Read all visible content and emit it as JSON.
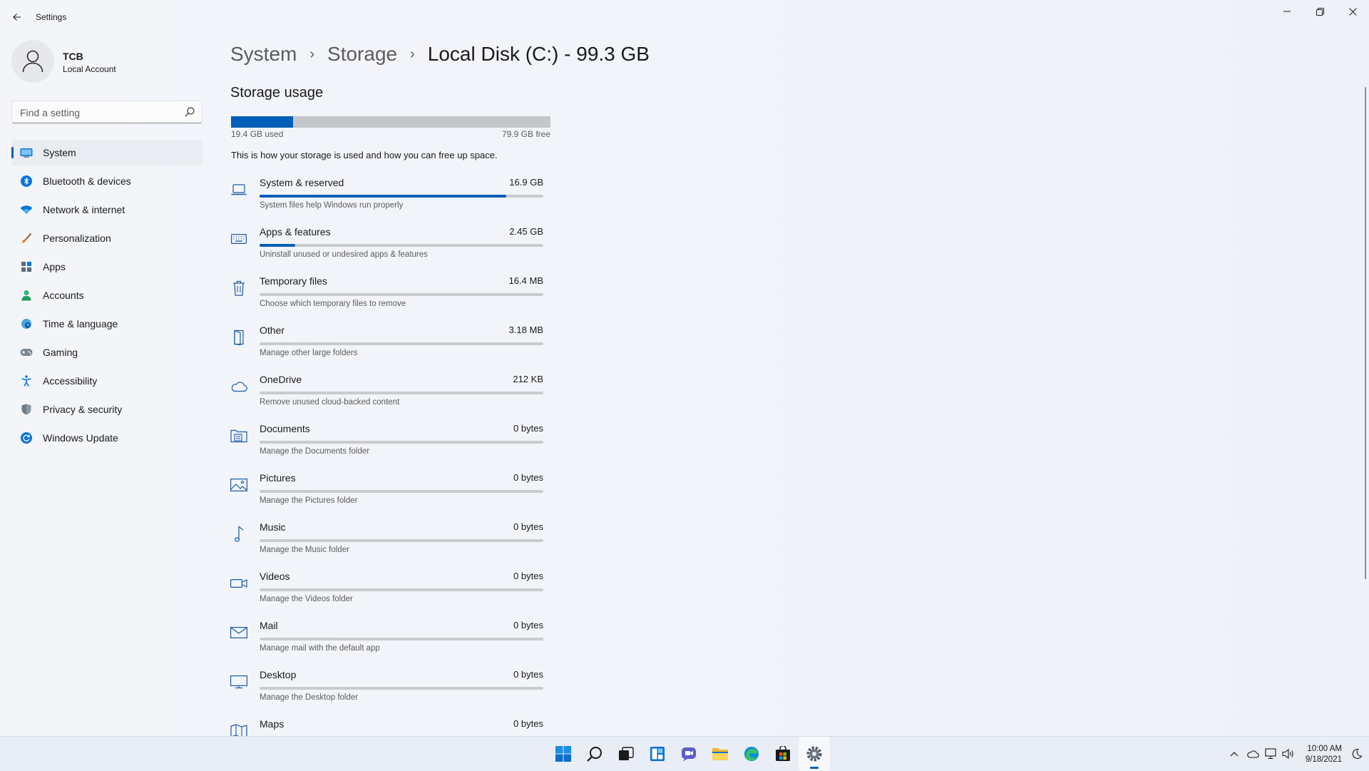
{
  "window": {
    "title": "Settings",
    "controls": [
      "minimize",
      "restore",
      "close"
    ]
  },
  "profile": {
    "name": "TCB",
    "account_type": "Local Account"
  },
  "search": {
    "placeholder": "Find a setting"
  },
  "nav": {
    "items": [
      {
        "label": "System",
        "icon": "system-icon",
        "active": true
      },
      {
        "label": "Bluetooth & devices",
        "icon": "bluetooth-icon"
      },
      {
        "label": "Network & internet",
        "icon": "wifi-icon"
      },
      {
        "label": "Personalization",
        "icon": "brush-icon"
      },
      {
        "label": "Apps",
        "icon": "apps-icon"
      },
      {
        "label": "Accounts",
        "icon": "accounts-icon"
      },
      {
        "label": "Time & language",
        "icon": "globe-clock-icon"
      },
      {
        "label": "Gaming",
        "icon": "gamepad-icon"
      },
      {
        "label": "Accessibility",
        "icon": "accessibility-icon"
      },
      {
        "label": "Privacy & security",
        "icon": "shield-icon"
      },
      {
        "label": "Windows Update",
        "icon": "update-icon"
      }
    ]
  },
  "breadcrumb": {
    "level1": "System",
    "level2": "Storage",
    "current": "Local Disk (C:) - 99.3 GB"
  },
  "storage": {
    "title": "Storage usage",
    "used_label": "19.4 GB used",
    "free_label": "79.9 GB free",
    "used_fraction": 0.195,
    "description": "This is how your storage is used and how you can free up space."
  },
  "categories": [
    {
      "name": "System & reserved",
      "size": "16.9 GB",
      "desc": "System files help Windows run properly",
      "fraction": 0.87,
      "icon": "laptop-icon"
    },
    {
      "name": "Apps & features",
      "size": "2.45 GB",
      "desc": "Uninstall unused or undesired apps & features",
      "fraction": 0.126,
      "icon": "keyboard-icon"
    },
    {
      "name": "Temporary files",
      "size": "16.4 MB",
      "desc": "Choose which temporary files to remove",
      "fraction": 0.0,
      "icon": "trash-icon"
    },
    {
      "name": "Other",
      "size": "3.18 MB",
      "desc": "Manage other large folders",
      "fraction": 0.0,
      "icon": "door-icon"
    },
    {
      "name": "OneDrive",
      "size": "212 KB",
      "desc": "Remove unused cloud-backed content",
      "fraction": 0.0,
      "icon": "cloud-icon"
    },
    {
      "name": "Documents",
      "size": "0 bytes",
      "desc": "Manage the Documents folder",
      "fraction": 0.0,
      "icon": "documents-folder-icon"
    },
    {
      "name": "Pictures",
      "size": "0 bytes",
      "desc": "Manage the Pictures folder",
      "fraction": 0.0,
      "icon": "picture-icon"
    },
    {
      "name": "Music",
      "size": "0 bytes",
      "desc": "Manage the Music folder",
      "fraction": 0.0,
      "icon": "music-note-icon"
    },
    {
      "name": "Videos",
      "size": "0 bytes",
      "desc": "Manage the Videos folder",
      "fraction": 0.0,
      "icon": "video-camera-icon"
    },
    {
      "name": "Mail",
      "size": "0 bytes",
      "desc": "Manage mail with the default app",
      "fraction": 0.0,
      "icon": "mail-icon"
    },
    {
      "name": "Desktop",
      "size": "0 bytes",
      "desc": "Manage the Desktop folder",
      "fraction": 0.0,
      "icon": "desktop-monitor-icon"
    },
    {
      "name": "Maps",
      "size": "0 bytes",
      "desc": "",
      "fraction": 0.0,
      "icon": "map-icon"
    }
  ],
  "taskbar": {
    "apps": [
      "start-icon",
      "search-icon",
      "task-view-icon",
      "widgets-icon",
      "chat-icon",
      "file-explorer-icon",
      "edge-icon",
      "store-icon",
      "settings-icon"
    ],
    "active_app": "settings-icon",
    "time": "10:00 AM",
    "date": "9/18/2021"
  },
  "colors": {
    "accent": "#005fb8",
    "bar_track": "#c4c6ca",
    "background": "#f3f5f9"
  }
}
